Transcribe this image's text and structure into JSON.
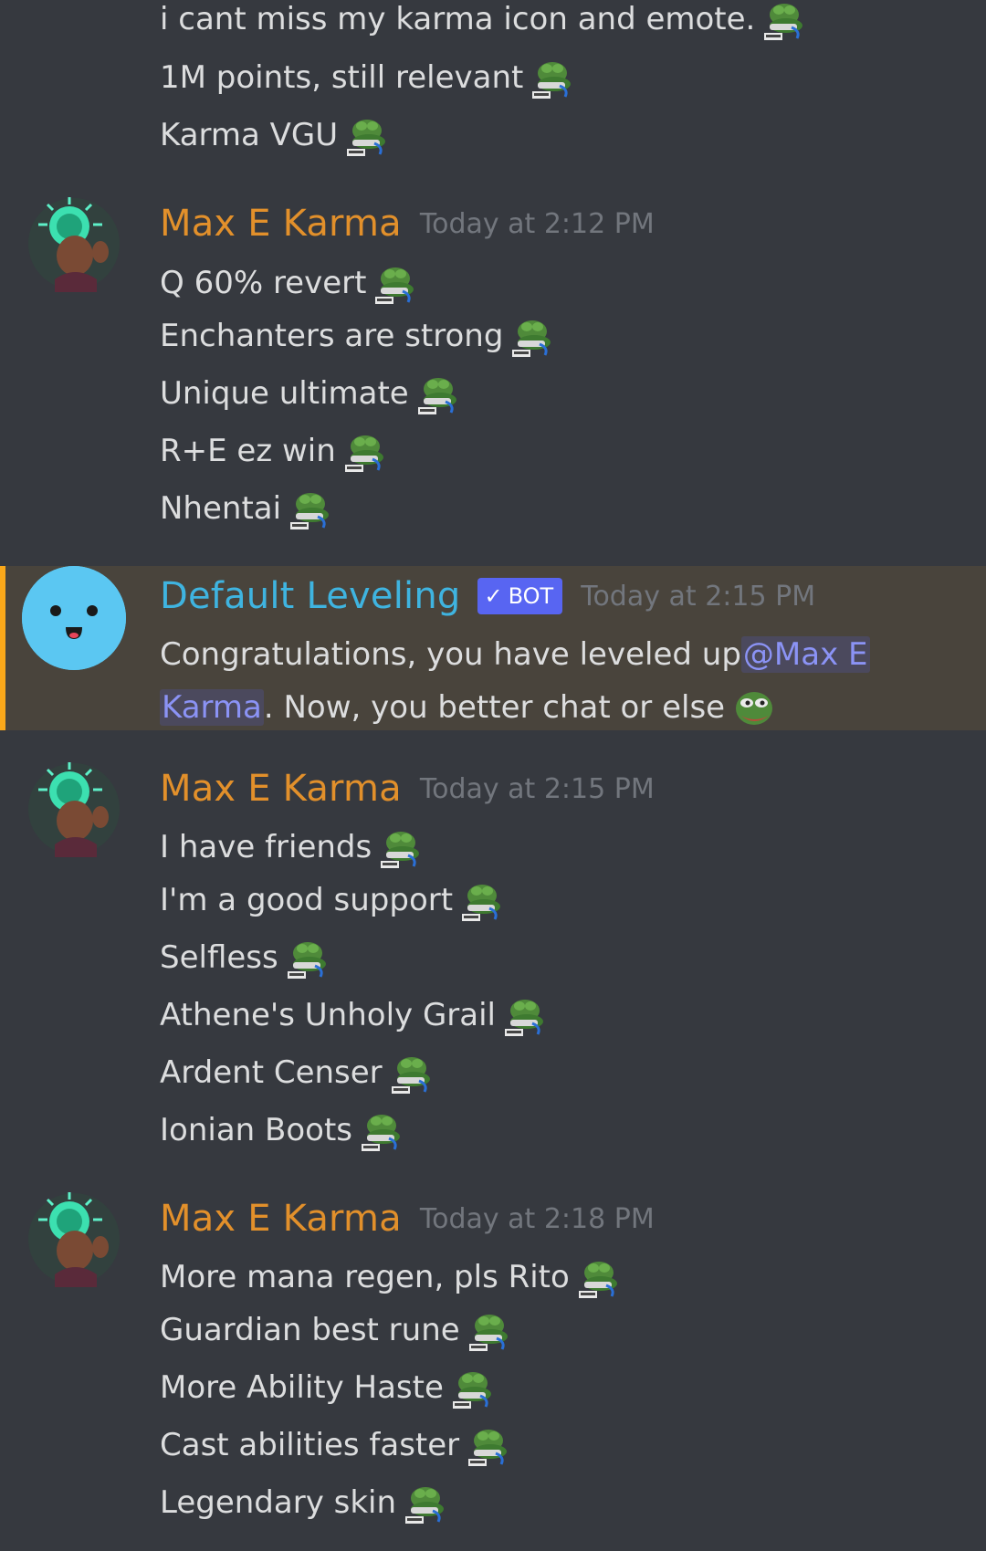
{
  "colors": {
    "background": "#36393f",
    "mention_background": "#49443c",
    "mention_bar": "#faa81a",
    "karma_name": "#e2902b",
    "bot_name": "#3fb4e0",
    "bot_tag": "#5865f2",
    "timestamp": "#72767d",
    "message_text": "#dcddde",
    "mention_text": "#8b93f5"
  },
  "messages": {
    "top_lines": [
      {
        "text": "i cant miss my karma icon and emote.",
        "emote": "copium-emote"
      },
      {
        "text": "1M points, still relevant",
        "emote": "copium-emote"
      },
      {
        "text": "Karma VGU",
        "emote": "copium-emote"
      }
    ],
    "group1": {
      "author": "Max E Karma",
      "timestamp": "Today at 2:12 PM",
      "lines": [
        {
          "text": "Q 60% revert"
        },
        {
          "text": "Enchanters are strong"
        },
        {
          "text": "Unique ultimate"
        },
        {
          "text": "R+E ez win"
        },
        {
          "text": "Nhentai"
        }
      ]
    },
    "bot": {
      "author": "Default Leveling",
      "tag": "BOT",
      "tag_check": "✓",
      "timestamp": "Today at 2:15 PM",
      "line1_text": "Congratulations, you have leveled up ",
      "mention_part1": "@Max E",
      "mention_part2": "Karma",
      "line2_text": " . Now, you better chat or else",
      "emote": "pepe-smile-emote"
    },
    "group2": {
      "author": "Max E Karma",
      "timestamp": "Today at 2:15 PM",
      "lines": [
        {
          "text": "I have friends"
        },
        {
          "text": "I'm a good support"
        },
        {
          "text": "Selfless"
        },
        {
          "text": "Athene's Unholy Grail"
        },
        {
          "text": "Ardent Censer"
        },
        {
          "text": "Ionian Boots"
        }
      ]
    },
    "group3": {
      "author": "Max E Karma",
      "timestamp": "Today at 2:18 PM",
      "lines": [
        {
          "text": "More mana regen, pls Rito"
        },
        {
          "text": "Guardian best rune"
        },
        {
          "text": "More Ability Haste"
        },
        {
          "text": "Cast abilities faster"
        },
        {
          "text": "Legendary skin"
        }
      ]
    }
  }
}
